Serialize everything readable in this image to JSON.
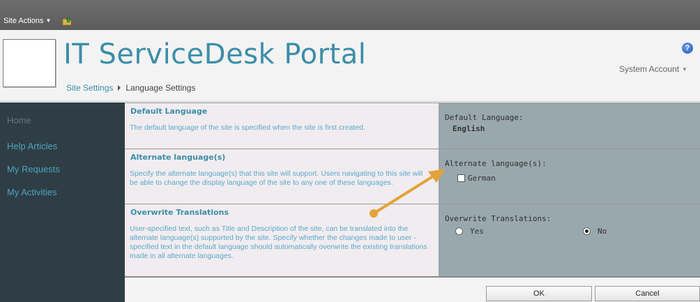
{
  "ribbon": {
    "site_actions": "Site Actions"
  },
  "header": {
    "site_title": "IT ServiceDesk Portal",
    "account": "System Account",
    "help_glyph": "?"
  },
  "breadcrumb": {
    "parent": "Site Settings",
    "current": "Language Settings"
  },
  "left_nav": {
    "items": [
      {
        "label": "Home"
      },
      {
        "label": "Help Articles"
      },
      {
        "label": "My Requests"
      },
      {
        "label": "My Activities"
      }
    ]
  },
  "sections": {
    "default_language": {
      "title": "Default Language",
      "description": "The default language of the site is specified when the site is first created.",
      "field_label": "Default Language:",
      "value": "English"
    },
    "alternate_languages": {
      "title": "Alternate language(s)",
      "description": "Specify the alternate language(s) that this site will support. Users navigating to this site will be able to change the display language of the site to any one of these languages.",
      "field_label": "Alternate language(s):",
      "options": [
        {
          "label": "German",
          "checked": false
        }
      ]
    },
    "overwrite_translations": {
      "title": "Overwrite Translations",
      "description": "User-specified text, such as Title and Description of the site, can be translated into the alternate language(s) supported by the site. Specify whether the changes made to user -specified text in the default language should automatically overwrite the existing translations made in all alternate languages.",
      "field_label": "Overwrite Translations:",
      "yes_label": "Yes",
      "no_label": "No",
      "selected": "No"
    }
  },
  "buttons": {
    "ok": "OK",
    "cancel": "Cancel"
  },
  "annotation": {
    "arrow_color": "#e3a23a"
  },
  "colors": {
    "accent": "#3b8ea8",
    "ribbon": "#5f5f5f",
    "left_nav": "#2e3e44",
    "control_panel": "#99a8ad"
  },
  "icons": {
    "navigate_up": "folder-up-icon",
    "help": "help-icon"
  }
}
